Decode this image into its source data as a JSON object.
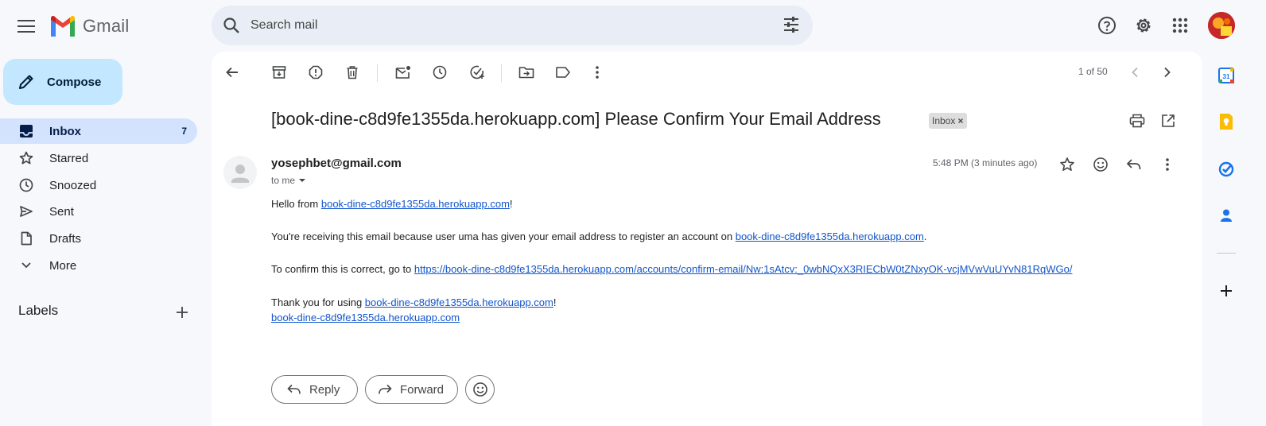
{
  "app": {
    "name": "Gmail"
  },
  "search": {
    "placeholder": "Search mail"
  },
  "compose": {
    "label": "Compose"
  },
  "nav": {
    "items": [
      {
        "label": "Inbox",
        "count": "7"
      },
      {
        "label": "Starred"
      },
      {
        "label": "Snoozed"
      },
      {
        "label": "Sent"
      },
      {
        "label": "Drafts"
      },
      {
        "label": "More"
      }
    ]
  },
  "labels": {
    "title": "Labels"
  },
  "toolbar": {
    "pager": "1 of 50"
  },
  "email": {
    "subject": "[book-dine-c8d9fe1355da.herokuapp.com] Please Confirm Your Email Address",
    "chip": "Inbox",
    "sender": "yosephbet@gmail.com",
    "to": "to me",
    "time": "5:48 PM (3 minutes ago)",
    "body": {
      "l1_pre": "Hello from ",
      "l1_link": "book-dine-c8d9fe1355da.herokuapp.com",
      "l1_post": "!",
      "l2_pre": "You're receiving this email because user uma has given your email address to register an account on ",
      "l2_link": "book-dine-c8d9fe1355da.herokuapp.com",
      "l2_post": ".",
      "l3_pre": "To confirm this is correct, go to ",
      "l3_link": "https://book-dine-c8d9fe1355da.herokuapp.com/accounts/confirm-email/Nw:1sAtcv:_0wbNQxX3RIECbW0tZNxyOK-vcjMVwVuUYvN81RqWGo/",
      "l4_pre": "Thank you for using ",
      "l4_link": "book-dine-c8d9fe1355da.herokuapp.com",
      "l4_post": "!",
      "l5_link": "book-dine-c8d9fe1355da.herokuapp.com"
    },
    "actions": {
      "reply": "Reply",
      "forward": "Forward"
    }
  },
  "colors": {
    "accent": "#0b57d0",
    "active_nav": "#d3e3fd",
    "compose_bg": "#c2e7ff",
    "link": "#1155cc"
  }
}
